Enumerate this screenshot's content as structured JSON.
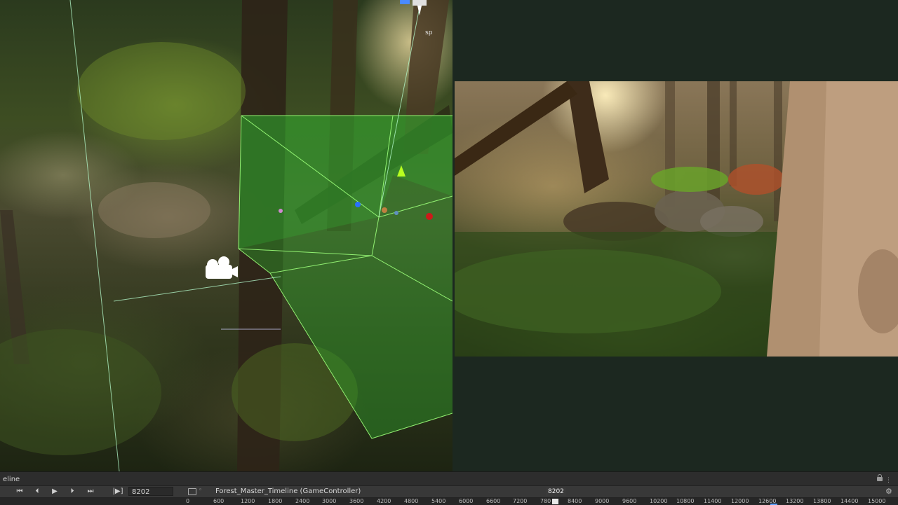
{
  "scene": {
    "camera_label": "sp"
  },
  "timeline": {
    "tab_title": "eline",
    "controls": {
      "first": "⏮",
      "prev": "⏴",
      "play": "▶",
      "next": "⏵",
      "last": "⏭",
      "frame_mode": "|▶]"
    },
    "current_frame": "8202",
    "asset_name": "Forest_Master_Timeline (GameController)",
    "asset_menu": "◦",
    "playhead_value": "8202",
    "ruler_ticks": [
      "0",
      "600",
      "1200",
      "1800",
      "2400",
      "3000",
      "3600",
      "4200",
      "4800",
      "5400",
      "6000",
      "6600",
      "7200",
      "780",
      "8400",
      "9000",
      "9600",
      "10200",
      "10800",
      "11400",
      "12000",
      "12600",
      "13200",
      "13800",
      "14400",
      "15000"
    ]
  },
  "colors": {
    "trigger_volume": "#33cc33",
    "selection": "#5aa0ff"
  }
}
